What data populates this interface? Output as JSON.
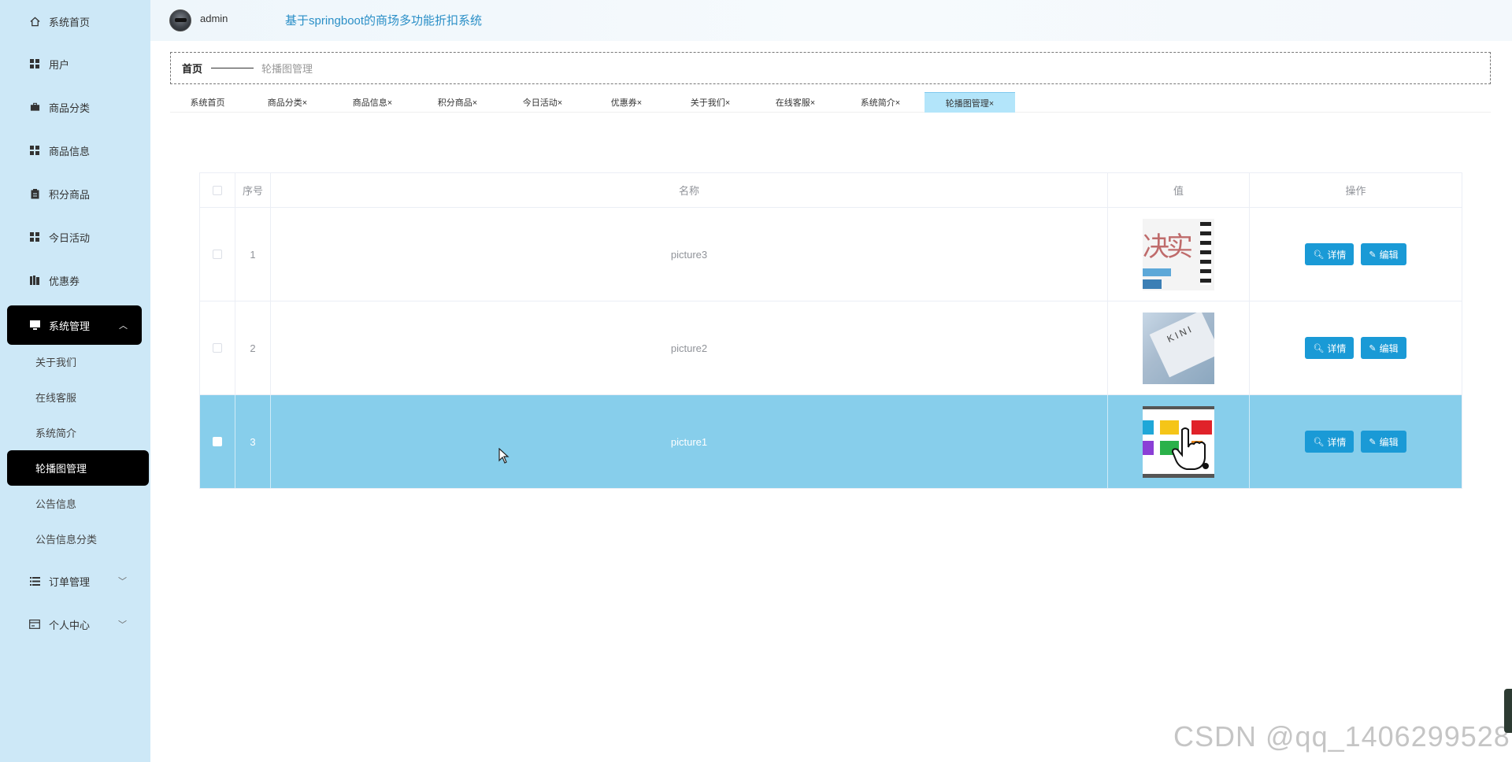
{
  "header": {
    "username": "admin",
    "system_title": "基于springboot的商场多功能折扣系统"
  },
  "sidebar": {
    "items": [
      {
        "label": "系统首页",
        "icon": "home-icon"
      },
      {
        "label": "用户",
        "icon": "grid-icon"
      },
      {
        "label": "商品分类",
        "icon": "briefcase-icon"
      },
      {
        "label": "商品信息",
        "icon": "grid-icon"
      },
      {
        "label": "积分商品",
        "icon": "clipboard-icon"
      },
      {
        "label": "今日活动",
        "icon": "grid-icon"
      },
      {
        "label": "优惠券",
        "icon": "book-icon"
      },
      {
        "label": "系统管理",
        "icon": "monitor-icon"
      },
      {
        "label": "订单管理",
        "icon": "list-icon"
      },
      {
        "label": "个人中心",
        "icon": "card-icon"
      }
    ],
    "submenu": [
      {
        "label": "关于我们"
      },
      {
        "label": "在线客服"
      },
      {
        "label": "系统简介"
      },
      {
        "label": "轮播图管理"
      },
      {
        "label": "公告信息"
      },
      {
        "label": "公告信息分类"
      }
    ]
  },
  "breadcrumb": {
    "home": "首页",
    "current": "轮播图管理"
  },
  "tabs": [
    {
      "label": "系统首页"
    },
    {
      "label": "商品分类×"
    },
    {
      "label": "商品信息×"
    },
    {
      "label": "积分商品×"
    },
    {
      "label": "今日活动×"
    },
    {
      "label": "优惠券×"
    },
    {
      "label": "关于我们×"
    },
    {
      "label": "在线客服×"
    },
    {
      "label": "系统简介×"
    },
    {
      "label": "轮播图管理×"
    }
  ],
  "table": {
    "headers": {
      "index": "序号",
      "name": "名称",
      "value": "值",
      "actions": "操作"
    },
    "rows": [
      {
        "index": "1",
        "name": "picture3"
      },
      {
        "index": "2",
        "name": "picture2"
      },
      {
        "index": "3",
        "name": "picture1"
      }
    ],
    "detail_label": "详情",
    "edit_label": "编辑"
  },
  "watermark": "CSDN @qq_1406299528",
  "colors": {
    "sidebar_bg": "#cde8f7",
    "active_bg": "#000000",
    "accent": "#1a9ad6",
    "selected_row": "#87ceeb",
    "title": "#2a8fc7"
  }
}
